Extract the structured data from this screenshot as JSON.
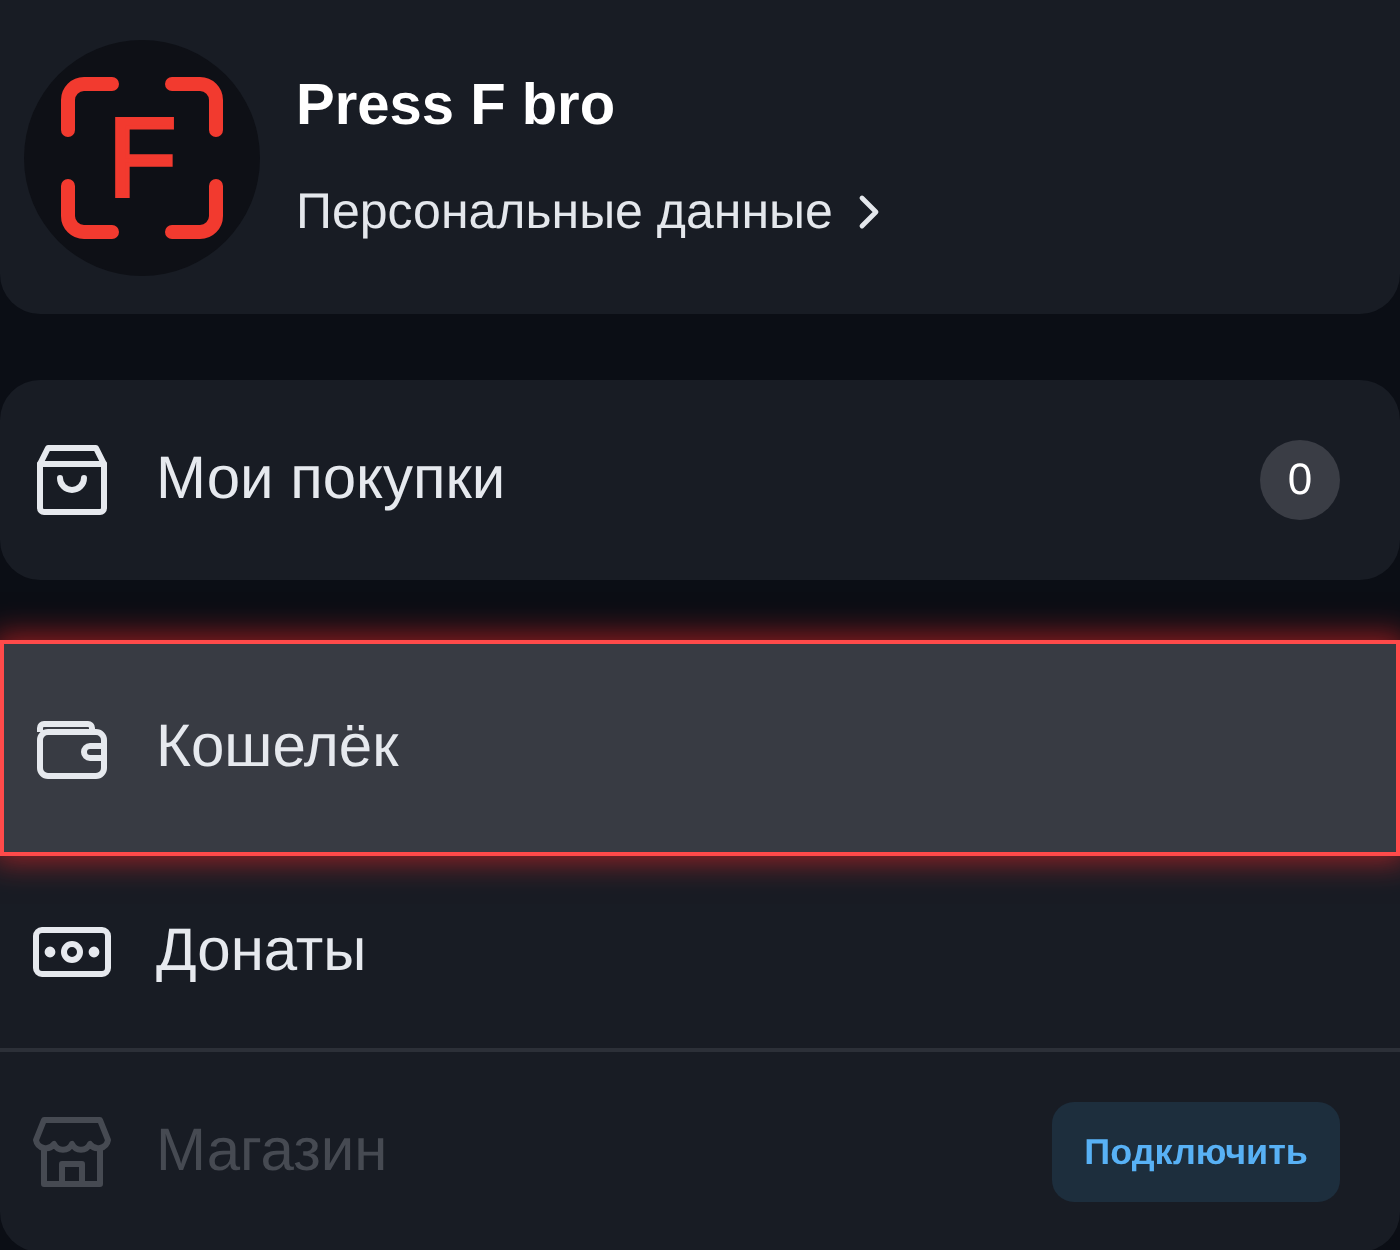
{
  "profile": {
    "avatar_letter": "F",
    "name": "Press F bro",
    "link": "Персональные данные"
  },
  "groups": [
    {
      "items": [
        {
          "label": "Мои покупки",
          "badge": "0",
          "selected": false,
          "disabled": false
        }
      ]
    },
    {
      "items": [
        {
          "label": "Кошелёк",
          "selected": true,
          "disabled": false
        },
        {
          "label": "Донаты",
          "selected": false,
          "disabled": false
        },
        {
          "label": "Магазин",
          "selected": false,
          "disabled": true,
          "button": "Подключить"
        }
      ]
    }
  ]
}
